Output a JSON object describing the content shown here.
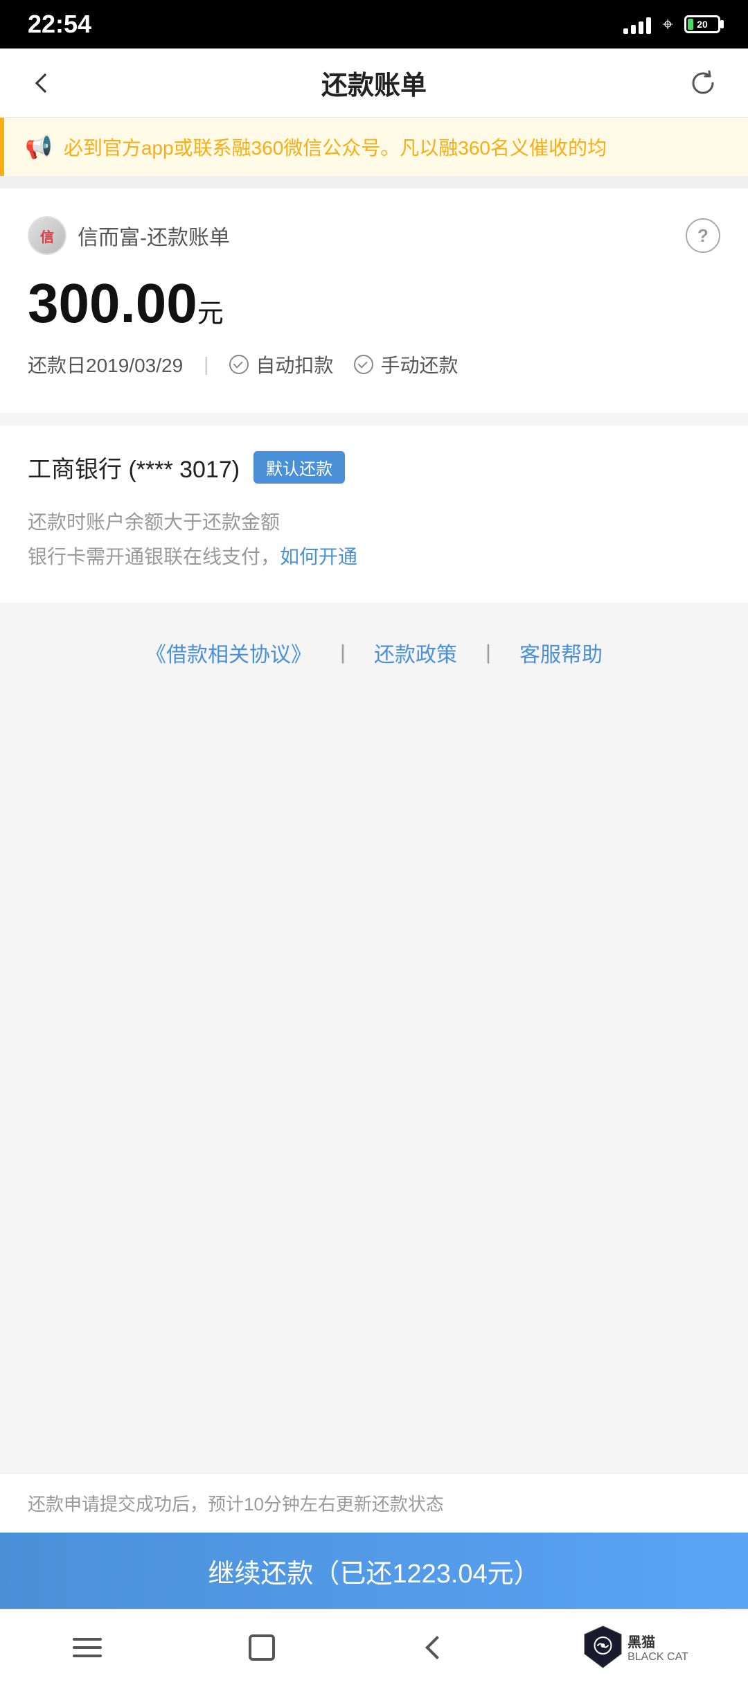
{
  "statusBar": {
    "time": "22:54",
    "battery": "20"
  },
  "navBar": {
    "title": "还款账单",
    "backLabel": "返回",
    "refreshLabel": "刷新"
  },
  "warning": {
    "text": "必到官方app或联系融360微信公众号。凡以融360名义催收的均"
  },
  "loanCard": {
    "providerLogo": "信",
    "providerName": "信而富-还款账单",
    "helpLabel": "?",
    "amount": "300.00",
    "amountUnit": "元",
    "dueDate": "还款日2019/03/29",
    "autoDeduct": "自动扣款",
    "manualRepay": "手动还款"
  },
  "bankSection": {
    "bankName": "工商银行 (**** 3017)",
    "defaultBadge": "默认还款",
    "note1": "还款时账户余额大于还款金额",
    "note2": "银行卡需开通银联在线支付，",
    "noteLink": "如何开通"
  },
  "links": {
    "loan": "《借款相关协议》",
    "separator1": "丨",
    "policy": "还款政策",
    "separator2": "丨",
    "support": "客服帮助"
  },
  "bottomNote": {
    "text": "还款申请提交成功后，预计10分钟左右更新还款状态"
  },
  "ctaButton": {
    "label": "继续还款（已还1223.04元）"
  },
  "bottomNav": {
    "menu": "菜单",
    "home": "主页",
    "back": "返回"
  }
}
